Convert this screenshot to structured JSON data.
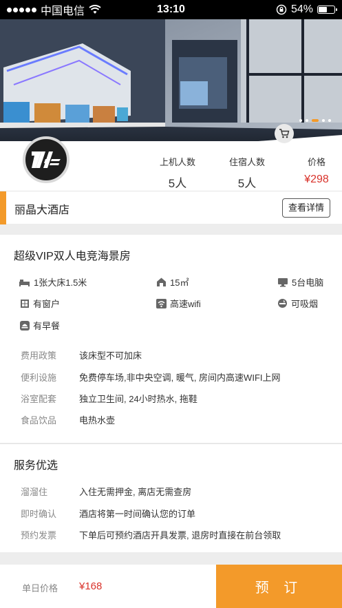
{
  "status_bar": {
    "carrier": "中国电信",
    "time": "13:10",
    "battery_text": "54%",
    "battery_level": 0.54,
    "icons": [
      "signal-dots-icon",
      "wifi-icon",
      "rotation-lock-icon",
      "battery-icon"
    ]
  },
  "hero": {
    "slide_count": 5,
    "active_slide": 3,
    "cart_icon": "cart-icon"
  },
  "stats": [
    {
      "label": "上机人数",
      "value": "5人"
    },
    {
      "label": "住宿人数",
      "value": "5人"
    },
    {
      "label": "价格",
      "value": "¥298"
    }
  ],
  "hotel": {
    "name": "丽晶大酒店",
    "detail_button": "查看详情",
    "accent_color": "#f39a2a"
  },
  "room": {
    "title": "超级VIP双人电竞海景房",
    "features": [
      {
        "icon": "bed-icon",
        "text": "1张大床1.5米"
      },
      {
        "icon": "area-icon",
        "text": "15㎡"
      },
      {
        "icon": "computer-icon",
        "text": "5台电脑"
      },
      {
        "icon": "window-icon",
        "text": "有窗户"
      },
      {
        "icon": "wifi-icon",
        "text": "高速wifi"
      },
      {
        "icon": "smoking-icon",
        "text": "可吸烟"
      },
      {
        "icon": "breakfast-icon",
        "text": "有早餐"
      }
    ],
    "policies": [
      {
        "key": "费用政策",
        "value": "该床型不可加床"
      },
      {
        "key": "便利设施",
        "value": "免费停车场,非中央空调, 暖气, 房间内高速WIFI上网"
      },
      {
        "key": "浴室配套",
        "value": "独立卫生间, 24小时热水, 拖鞋"
      },
      {
        "key": "食品饮品",
        "value": "电热水壶"
      }
    ]
  },
  "service": {
    "title": "服务优选",
    "items": [
      {
        "key": "溜溜住",
        "value": "入住无需押金, 离店无需查房"
      },
      {
        "key": "即时确认",
        "value": "酒店将第一时间确认您的订单"
      },
      {
        "key": "预约发票",
        "value": "下单后可预约酒店开具发票, 退房时直接在前台领取"
      }
    ]
  },
  "footer": {
    "day_price_label": "单日价格",
    "day_price": "¥168",
    "book_button": "预 订",
    "price_color": "#d9332b"
  }
}
